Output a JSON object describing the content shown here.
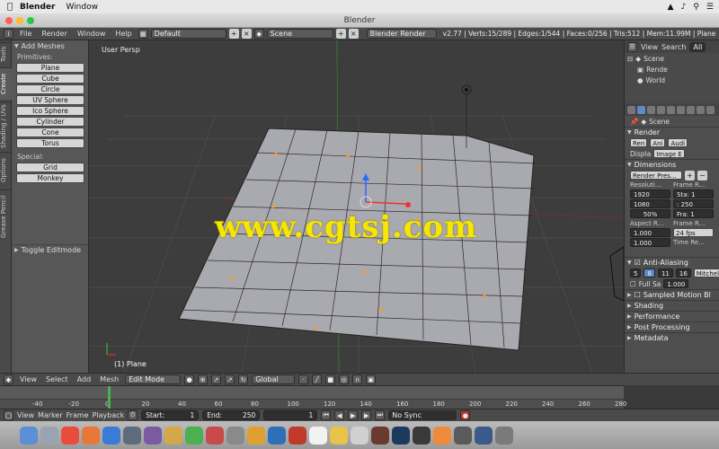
{
  "mac_menubar": {
    "app_name": "Blender",
    "menu_window": "Window",
    "time": ""
  },
  "window_title": "Blender",
  "info_header": {
    "menus": [
      "File",
      "Render",
      "Window",
      "Help"
    ],
    "layout": "Default",
    "scene": "Scene",
    "engine": "Blender Render",
    "stats": "v2.77 | Verts:15/289 | Edges:1/544 | Faces:0/256 | Tris:512 | Mem:11.99M | Plane"
  },
  "left_tabs": [
    "Tools",
    "Create",
    "Shading / UVs",
    "Options",
    "Grease Pencil"
  ],
  "toolshelf": {
    "panel_title": "Add Meshes",
    "primitives_label": "Primitives:",
    "primitives": [
      "Plane",
      "Cube",
      "Circle",
      "UV Sphere",
      "Ico Sphere",
      "Cylinder",
      "Cone",
      "Torus"
    ],
    "special_label": "Special:",
    "special": [
      "Grid",
      "Monkey"
    ],
    "toggle_editmode": "Toggle Editmode"
  },
  "viewport": {
    "view_name": "User Persp",
    "object_label": "(1) Plane",
    "watermark": "www.cgtsj.com"
  },
  "viewport_header": {
    "menus": [
      "View",
      "Select",
      "Add",
      "Mesh"
    ],
    "mode": "Edit Mode",
    "orientation": "Global"
  },
  "timeline": {
    "ticks": [
      "-40",
      "-20",
      "0",
      "20",
      "40",
      "60",
      "80",
      "100",
      "120",
      "140",
      "160",
      "180",
      "200",
      "220",
      "240",
      "260",
      "280"
    ],
    "current_frame_value": 0
  },
  "timeline_header": {
    "menus": [
      "View",
      "Marker",
      "Frame",
      "Playback"
    ],
    "start_label": "Start:",
    "start_value": "1",
    "end_label": "End:",
    "end_value": "250",
    "current": "1",
    "sync": "No Sync"
  },
  "outliner": {
    "menus": [
      "View",
      "Search",
      "All"
    ],
    "items": [
      "Scene",
      "Rende",
      "World"
    ]
  },
  "properties": {
    "scene_label": "Scene",
    "render_title": "Render",
    "render_buttons": [
      "Ren",
      "Ani",
      "Audi"
    ],
    "display_label": "Displa",
    "display_value": "Image E",
    "dimensions_title": "Dimensions",
    "preset": "Render Pres...",
    "resolution_label": "Resoluti...",
    "frame_range_label": "Frame R...",
    "res_x": "1920",
    "res_y": "1080",
    "res_pct": "50%",
    "start_field": "Sta: 1",
    "end_field": ": 250",
    "frame_field": "Fra: 1",
    "aspect_label": "Aspect R...",
    "frame_rate_label": "Frame R...",
    "aspect_x": "1.000",
    "aspect_y": "1.000",
    "fps": "24 fps",
    "time_remap_label": "Time Re...",
    "aa_title": "Anti-Aliasing",
    "aa_values": [
      "5",
      "8",
      "11",
      "16"
    ],
    "aa_filter": "Mitchell-",
    "full_sample": "Full Sa",
    "aa_size": "1.000",
    "sections": [
      "Sampled Motion Bl",
      "Shading",
      "Performance",
      "Post Processing",
      "Metadata"
    ]
  }
}
